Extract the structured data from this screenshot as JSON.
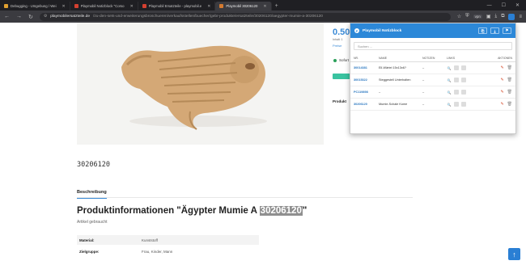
{
  "browser": {
    "tabs": [
      {
        "label": "Debugging - Umgebung / Wei",
        "active": false,
        "icon_color": "#e0a030"
      },
      {
        "label": "Playmobil Notizblock \"Corso",
        "active": false,
        "icon_color": "#d44030"
      },
      {
        "label": "Playmobil Ersatzteile - playmobil.e",
        "active": false,
        "icon_color": "#d44030"
      },
      {
        "label": "Playmobil 30206120",
        "active": true,
        "icon_color": "#d47a30"
      }
    ],
    "url_host": "playmobilersatzteile.de",
    "url_path": "/zu-den-sets-und-erweiterungsbroschueren/verkaufsstellen/buecher/gebr-produkte/ersatzteile/30206120/aegypter-mumie-a-30206120"
  },
  "product": {
    "price": "0.50",
    "side_text_1": "Inhalt: 1",
    "side_text_2": "Preise",
    "stock": "Sofort",
    "side_heading": "Produkt",
    "number": "30206120",
    "tab_label": "Beschreibung",
    "title_prefix": "Produktinformationen \"Ägypter Mumie A ",
    "title_highlight": "30206120",
    "title_suffix": "\"",
    "condition": "Artikel gebraucht",
    "specs": [
      {
        "key": "Material:",
        "value": "Kunststoff"
      },
      {
        "key": "Zielgruppe:",
        "value": "Frau, Kinder, Mann"
      }
    ]
  },
  "popup": {
    "title": "Playmobil Notizblock",
    "search_placeholder": "Suchen ...",
    "columns": [
      "NR.",
      "NAME",
      "NOTIZEN",
      "LINKS",
      "AKTIONEN"
    ],
    "rows": [
      {
        "nr": "30014381",
        "name": "Ell-Wärtel 15x13x6?",
        "notiz": "–"
      },
      {
        "nr": "30015322",
        "name": "Steggestell Unterhalten",
        "notiz": "–"
      },
      {
        "nr": "PC119898",
        "name": "–",
        "notiz": "–"
      },
      {
        "nr": "30206120",
        "name": "Mumie-Schale Kome",
        "notiz": "–"
      }
    ]
  }
}
